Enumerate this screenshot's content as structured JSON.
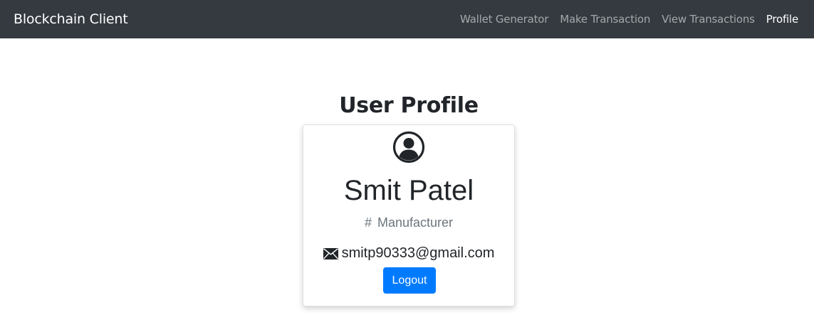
{
  "navbar": {
    "brand": "Blockchain Client",
    "links": [
      {
        "label": "Wallet Generator",
        "active": false
      },
      {
        "label": "Make Transaction",
        "active": false
      },
      {
        "label": "View Transactions",
        "active": false
      },
      {
        "label": "Profile",
        "active": true
      }
    ]
  },
  "main": {
    "title": "User Profile",
    "card": {
      "avatar_icon": "user-circle-icon",
      "name": "Smit Patel",
      "role_symbol": "#",
      "role": "Manufacturer",
      "email_icon": "envelope-icon",
      "email": "smitp90333@gmail.com",
      "logout_label": "Logout"
    }
  },
  "colors": {
    "navbar_bg": "#343a40",
    "primary": "#007bff",
    "muted": "#6c757d"
  }
}
